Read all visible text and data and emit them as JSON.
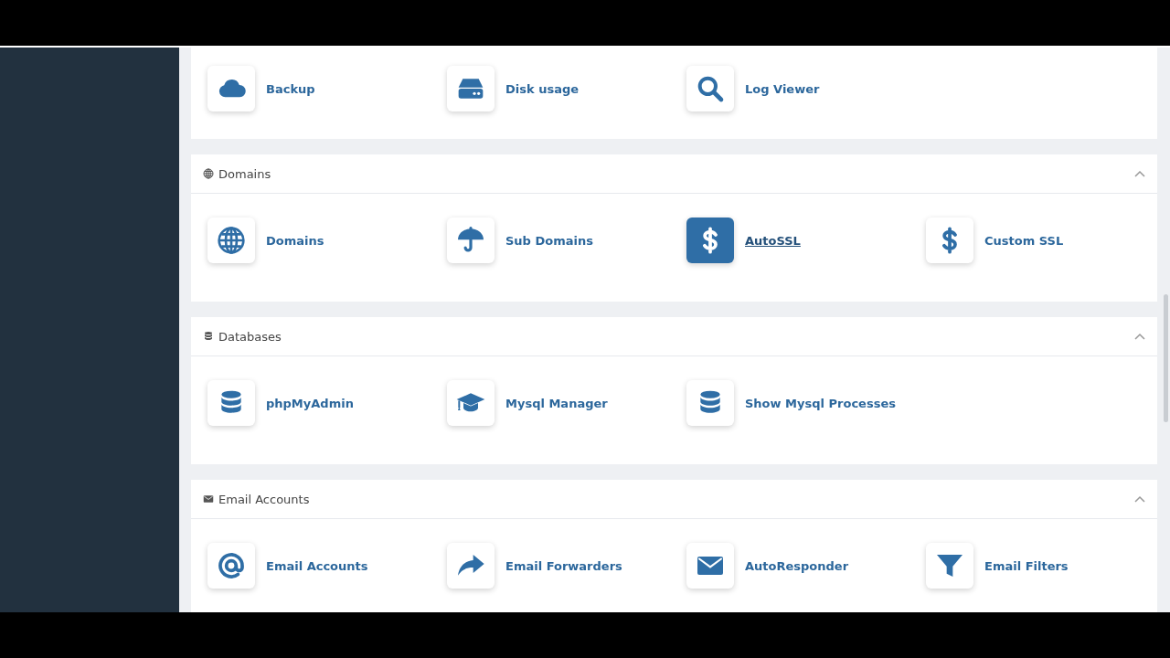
{
  "sections": [
    {
      "items": [
        {
          "label": "Backup",
          "selected": false
        },
        {
          "label": "Disk usage",
          "selected": false
        },
        {
          "label": "Log Viewer",
          "selected": false
        }
      ]
    },
    {
      "title": "Domains",
      "expanded": true,
      "items": [
        {
          "label": "Domains",
          "selected": false
        },
        {
          "label": "Sub Domains",
          "selected": false
        },
        {
          "label": "AutoSSL",
          "selected": true
        },
        {
          "label": "Custom SSL",
          "selected": false
        }
      ]
    },
    {
      "title": "Databases",
      "expanded": true,
      "items": [
        {
          "label": "phpMyAdmin",
          "selected": false
        },
        {
          "label": "Mysql Manager",
          "selected": false
        },
        {
          "label": "Show Mysql Processes",
          "selected": false
        }
      ]
    },
    {
      "title": "Email Accounts",
      "expanded": true,
      "items": [
        {
          "label": "Email Accounts",
          "selected": false
        },
        {
          "label": "Email Forwarders",
          "selected": false
        },
        {
          "label": "AutoResponder",
          "selected": false
        },
        {
          "label": "Email Filters",
          "selected": false
        }
      ]
    }
  ]
}
